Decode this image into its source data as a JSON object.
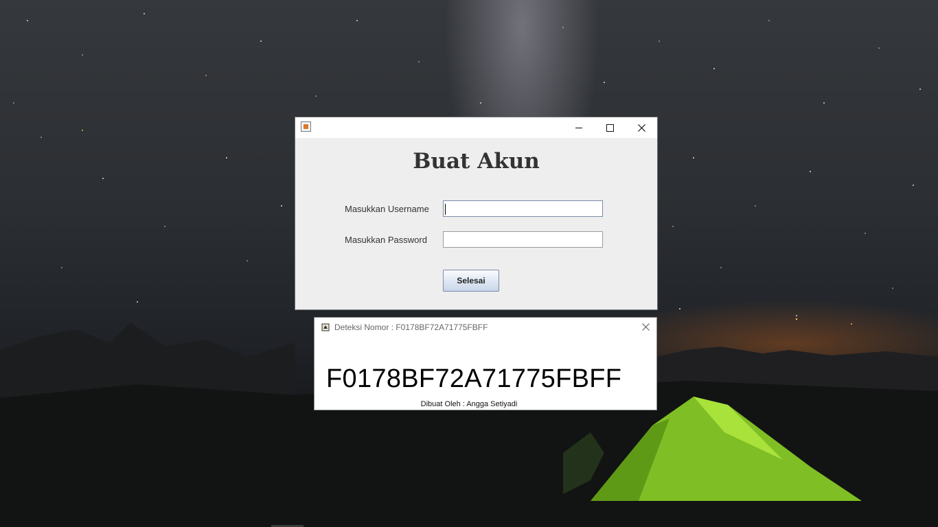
{
  "login_window": {
    "heading": "Buat Akun",
    "username_label": "Masukkan Username",
    "username_value": "",
    "password_label": "Masukkan Password",
    "password_value": "",
    "submit_label": "Selesai"
  },
  "detect_window": {
    "title": "Deteksi Nomor : F0178BF72A71775FBFF",
    "code": "F0178BF72A71775FBFF",
    "credit": "Dibuat Oleh : Angga Setiyadi"
  },
  "icons": {
    "login_app": "java-icon",
    "detect_app": "app-icon",
    "minimize": "minimize-icon",
    "maximize": "maximize-icon",
    "close": "close-icon"
  },
  "colors": {
    "button_gradient_top": "#fbfcfe",
    "button_gradient_bottom": "#c9d5e8",
    "window_bg": "#eeeeee",
    "tent": "#8fd12b"
  }
}
